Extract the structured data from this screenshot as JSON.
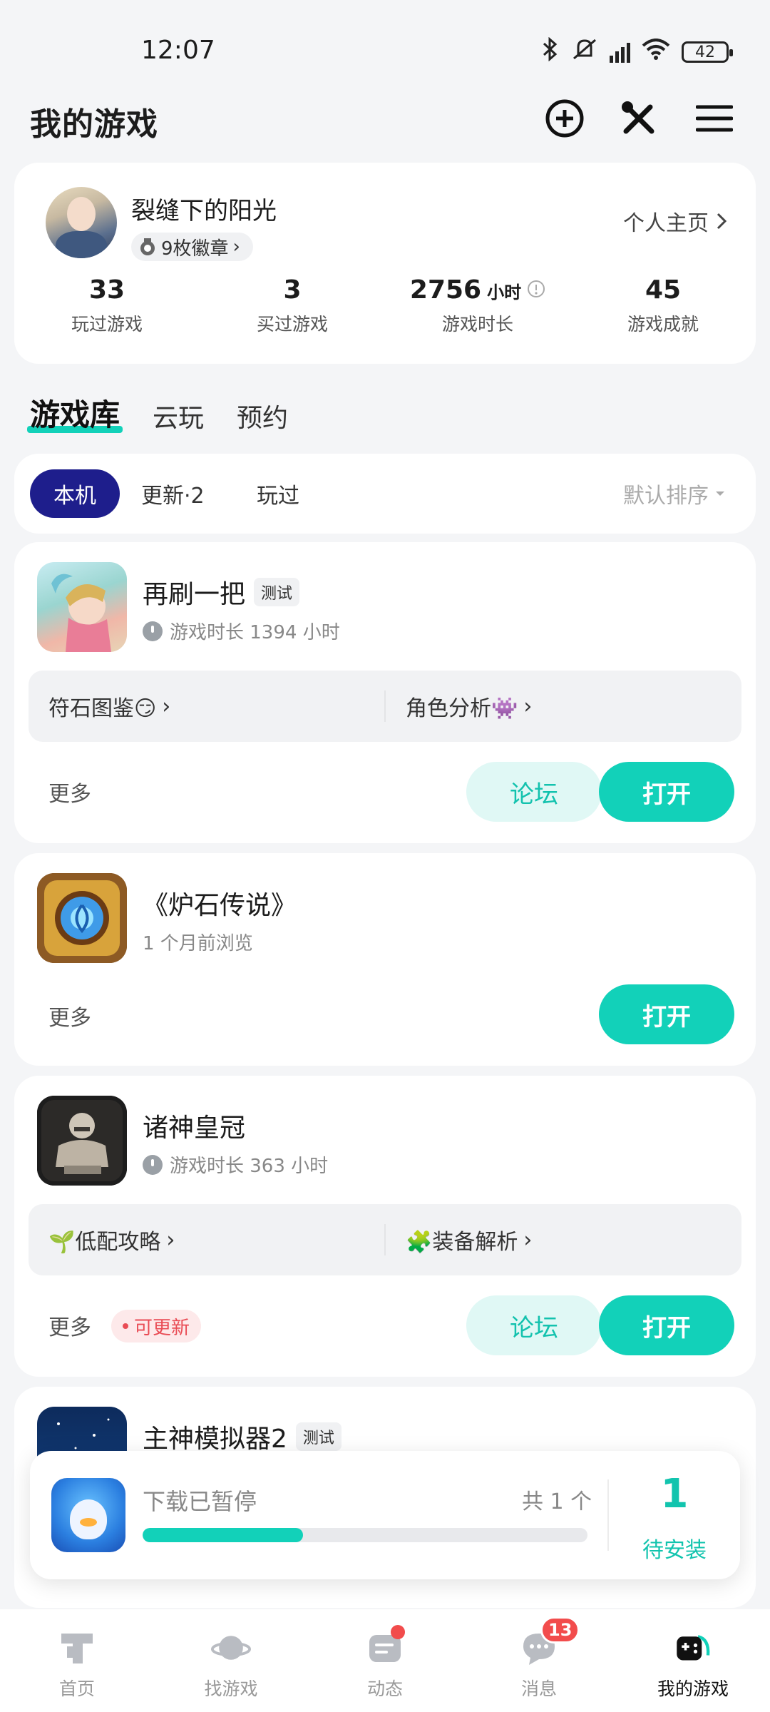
{
  "status_bar": {
    "time": "12:07",
    "battery": "42"
  },
  "header": {
    "title": "我的游戏"
  },
  "profile": {
    "username": "裂缝下的阳光",
    "badges": "9枚徽章",
    "homepage_link": "个人主页",
    "stats": [
      {
        "value": "33",
        "unit": "",
        "label": "玩过游戏"
      },
      {
        "value": "3",
        "unit": "",
        "label": "买过游戏"
      },
      {
        "value": "2756",
        "unit": "小时",
        "label": "游戏时长"
      },
      {
        "value": "45",
        "unit": "",
        "label": "游戏成就"
      }
    ]
  },
  "main_tabs": [
    "游戏库",
    "云玩",
    "预约"
  ],
  "filter": {
    "chips": [
      "本机",
      "更新·2",
      "玩过"
    ],
    "sort": "默认排序"
  },
  "games": [
    {
      "title": "再刷一把",
      "tag": "测试",
      "subtitle": "游戏时长 1394 小时",
      "shortcuts": [
        "符石图鉴😏",
        "角色分析👾"
      ],
      "more": "更多",
      "forum": "论坛",
      "open": "打开"
    },
    {
      "title": "《炉石传说》",
      "subtitle": "1 个月前浏览",
      "more": "更多",
      "open": "打开"
    },
    {
      "title": "诸神皇冠",
      "subtitle": "游戏时长 363 小时",
      "shortcuts": [
        "🌱低配攻略",
        "🧩装备解析"
      ],
      "more": "更多",
      "update": "可更新",
      "forum": "论坛",
      "open": "打开"
    },
    {
      "title": "主神模拟器2",
      "tag": "测试"
    }
  ],
  "download": {
    "status": "下载已暂停",
    "total": "共 1 个",
    "progress": 0.36,
    "count": "1",
    "pending_label": "待安装"
  },
  "bottom_nav": [
    {
      "label": "首页",
      "icon": "home-icon"
    },
    {
      "label": "找游戏",
      "icon": "planet-icon"
    },
    {
      "label": "动态",
      "icon": "feed-icon"
    },
    {
      "label": "消息",
      "icon": "message-icon",
      "badge": "13"
    },
    {
      "label": "我的游戏",
      "icon": "gamepad-icon"
    }
  ],
  "colors": {
    "accent": "#12d1b9",
    "chip_active": "#1e1e8c",
    "alert": "#f24c4c"
  }
}
